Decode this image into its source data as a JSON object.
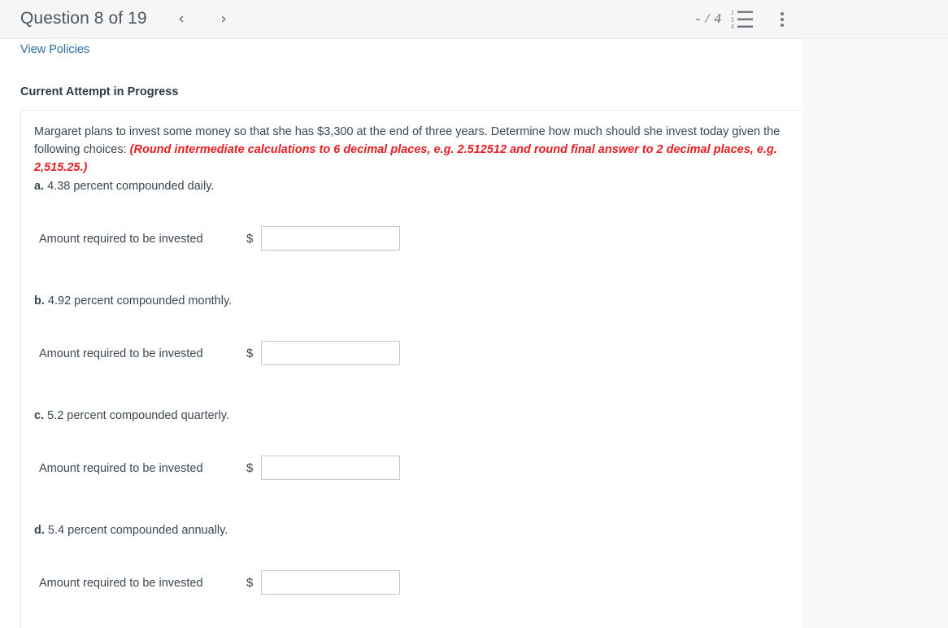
{
  "header": {
    "question_title": "Question 8 of 19",
    "prev_label": "‹",
    "next_label": "›",
    "score": "- / 4",
    "list_icon_name": "numbered-list-icon",
    "list_icon_numbers": [
      "1",
      "2",
      "3"
    ],
    "kebab_icon_name": "more-options-icon"
  },
  "panel": {
    "view_policies_label": "View Policies",
    "attempt_status": "Current Attempt in Progress"
  },
  "question": {
    "body_prefix": "Margaret plans to invest some money so that she has $3,300 at the end of three years. Determine how much should she invest today given the following choices: ",
    "emphasis": "(Round intermediate calculations to 6 decimal places, e.g. 2.512512 and round final answer to 2 decimal places, e.g. 2,515.25.)"
  },
  "parts": [
    {
      "letter": "a.",
      "text": " 4.38 percent compounded daily.",
      "answer_label": "Amount required to be invested",
      "currency_symbol": "$",
      "input_value": "",
      "input_placeholder": ""
    },
    {
      "letter": "b.",
      "text": " 4.92 percent compounded monthly.",
      "answer_label": "Amount required to be invested",
      "currency_symbol": "$",
      "input_value": "",
      "input_placeholder": ""
    },
    {
      "letter": "c.",
      "text": " 5.2 percent compounded quarterly.",
      "answer_label": "Amount required to be invested",
      "currency_symbol": "$",
      "input_value": "",
      "input_placeholder": ""
    },
    {
      "letter": "d.",
      "text": " 5.4 percent compounded annually.",
      "answer_label": "Amount required to be invested",
      "currency_symbol": "$",
      "input_value": "",
      "input_placeholder": ""
    }
  ],
  "colors": {
    "link": "#2b6ca3",
    "emphasis": "#e81d22",
    "text": "#3b4752",
    "header_bg": "#f6f6f6",
    "page_bg": "#f9f9f9"
  }
}
